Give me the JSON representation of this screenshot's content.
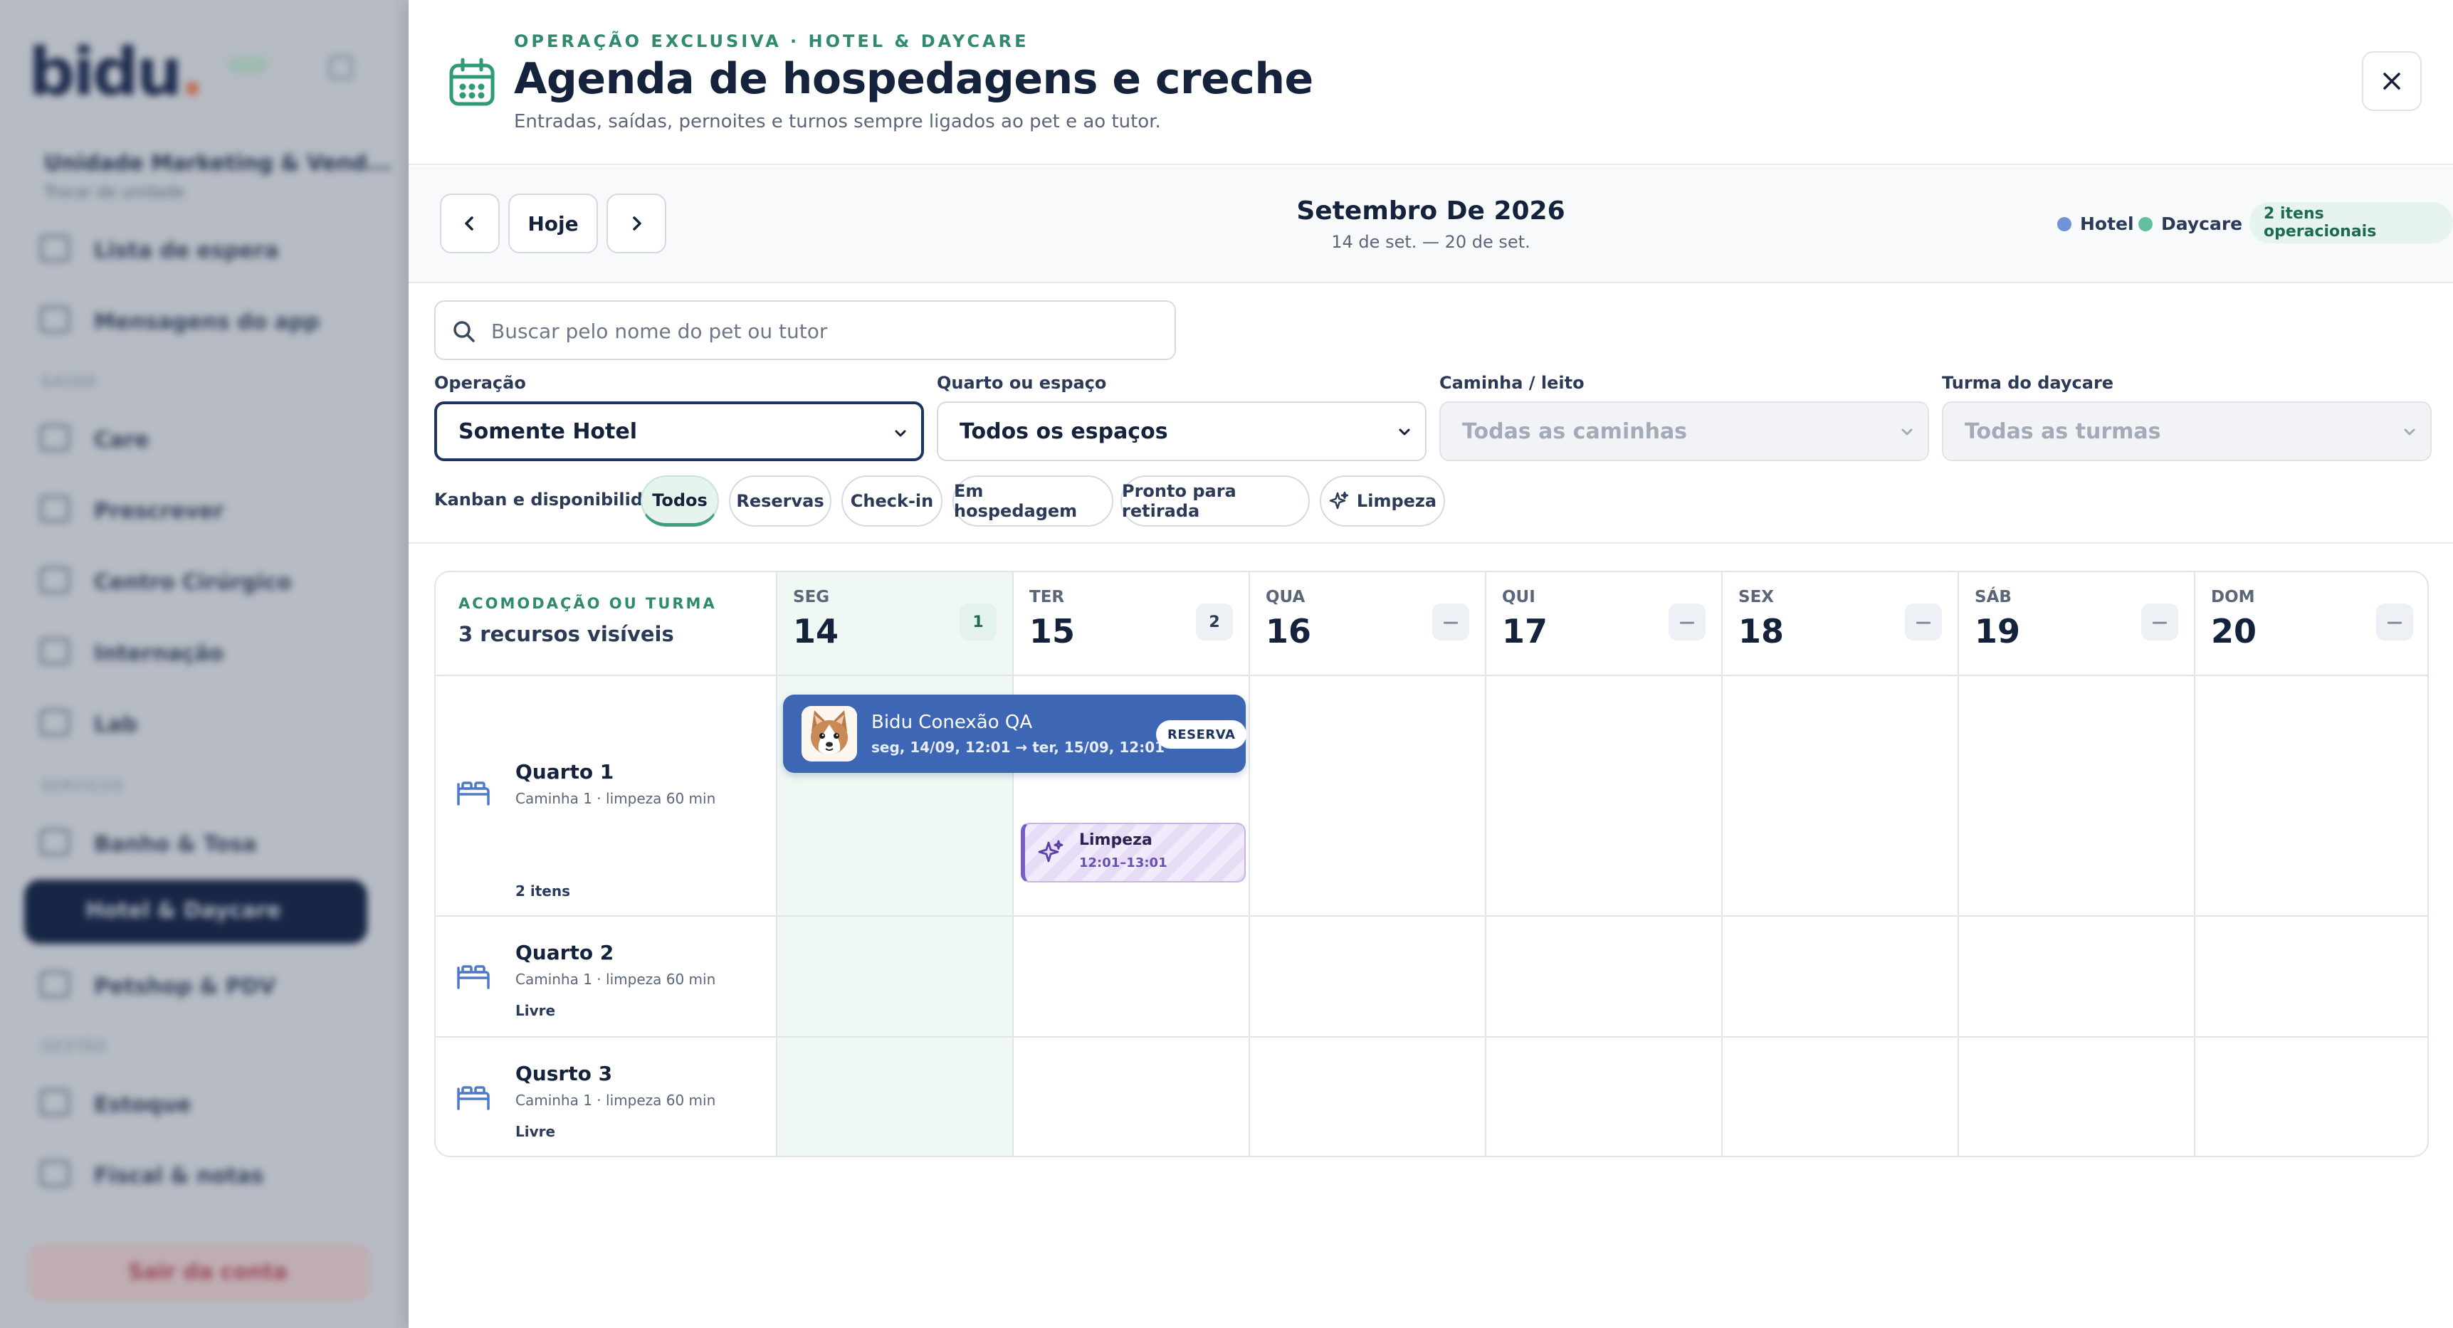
{
  "background": {
    "logo": "bidu",
    "unit_name": "Unidade Marketing & Vend...",
    "unit_sub": "Trocar de unidade",
    "items": [
      "Lista de espera",
      "Mensagens do app",
      "Care",
      "Prescrever",
      "Centro Cirúrgico",
      "Internação",
      "Lab",
      "Banho & Tosa",
      "Hotel & Daycare",
      "Petshop & PDV",
      "Estoque",
      "Fiscal & notas"
    ],
    "sections": [
      "SAÚDE",
      "SERVIÇOS",
      "GESTÃO"
    ],
    "logout": "Sair da conta"
  },
  "header": {
    "eyebrow": "OPERAÇÃO EXCLUSIVA · HOTEL & DAYCARE",
    "title": "Agenda de hospedagens e creche",
    "subtitle": "Entradas, saídas, pernoites e turnos sempre ligados ao pet e ao tutor."
  },
  "toolbar": {
    "today_label": "Hoje",
    "month_title": "Setembro De 2026",
    "range": "14 de set. — 20 de set.",
    "legend_hotel": "Hotel",
    "legend_daycare": "Daycare",
    "ops_badge": "2 itens operacionais",
    "colors": {
      "hotel": "#6f93d6",
      "daycare": "#5fbfa0"
    }
  },
  "filters": {
    "search_placeholder": "Buscar pelo nome do pet ou tutor",
    "search_value": "",
    "operation_label": "Operação",
    "operation_value": "Somente Hotel",
    "room_label": "Quarto ou espaço",
    "room_value": "Todos os espaços",
    "bed_label": "Caminha / leito",
    "bed_value": "Todas as caminhas",
    "group_label": "Turma do daycare",
    "group_value": "Todas as turmas",
    "kanban_label": "Kanban e disponibilidade",
    "chips": [
      "Todos",
      "Reservas",
      "Check-in",
      "Em hospedagem",
      "Pronto para retirada",
      "Limpeza"
    ]
  },
  "calendar": {
    "corner_label": "ACOMODAÇÃO OU TURMA",
    "corner_value": "3 recursos visíveis",
    "days": [
      {
        "dow": "SEG",
        "num": "14",
        "count": "1"
      },
      {
        "dow": "TER",
        "num": "15",
        "count": "2"
      },
      {
        "dow": "QUA",
        "num": "16",
        "count": "—"
      },
      {
        "dow": "QUI",
        "num": "17",
        "count": "—"
      },
      {
        "dow": "SEX",
        "num": "18",
        "count": "—"
      },
      {
        "dow": "SÁB",
        "num": "19",
        "count": "—"
      },
      {
        "dow": "DOM",
        "num": "20",
        "count": "—"
      }
    ],
    "rooms": [
      {
        "name": "Quarto 1",
        "sub": "Caminha 1 · limpeza 60 min",
        "status": "2 itens"
      },
      {
        "name": "Quarto 2",
        "sub": "Caminha 1 · limpeza 60 min",
        "status": "Livre"
      },
      {
        "name": "Qusrto 3",
        "sub": "Caminha 1 · limpeza 60 min",
        "status": "Livre"
      }
    ],
    "booking": {
      "pet": "Bidu Conexão QA",
      "time": "seg, 14/09, 12:01 → ter, 15/09, 12:01",
      "tag": "RESERVA"
    },
    "cleaning": {
      "title": "Limpeza",
      "time": "12:01–13:01"
    }
  }
}
